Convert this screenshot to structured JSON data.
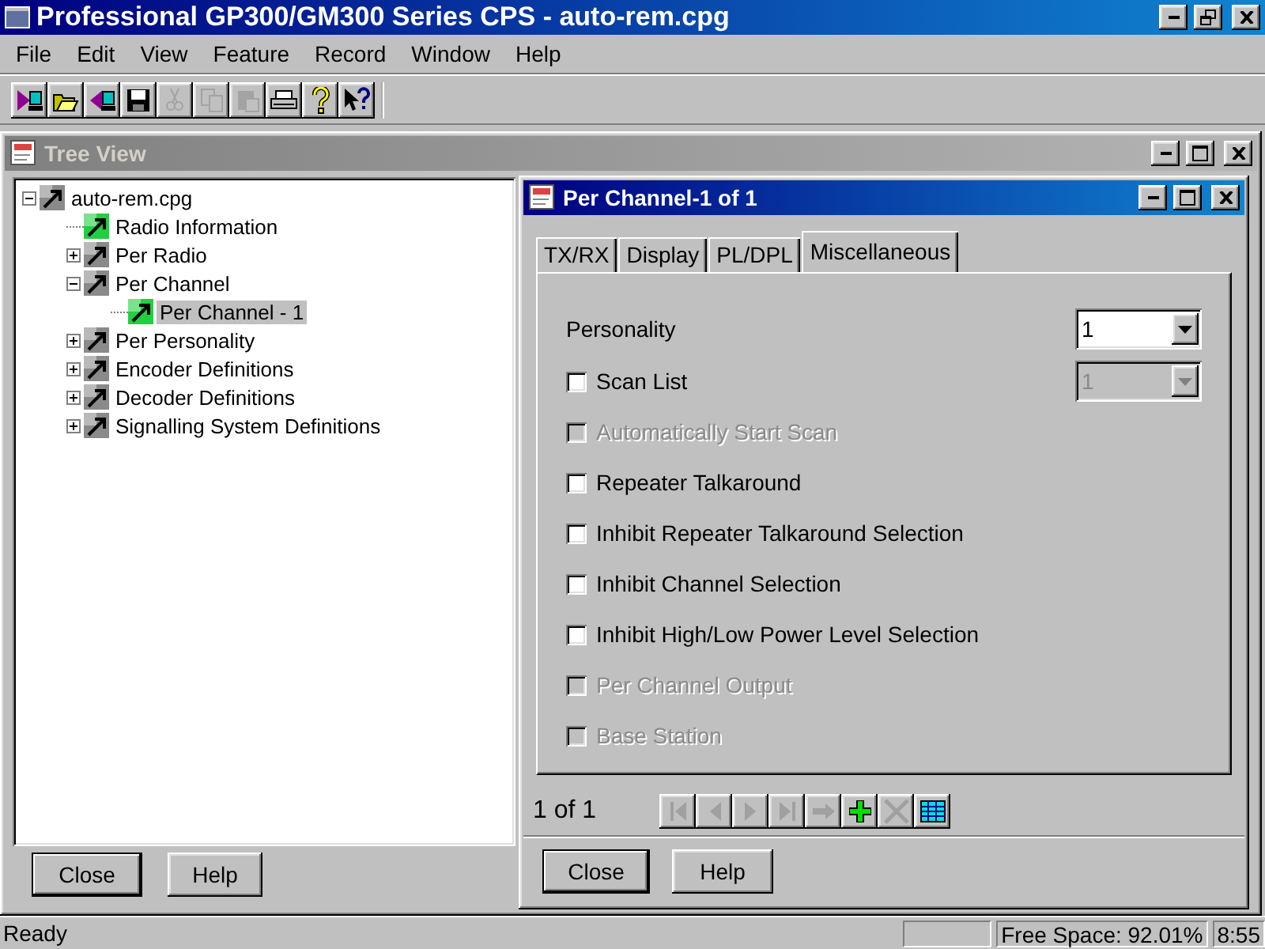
{
  "window": {
    "title": "Professional GP300/GM300 Series CPS - auto-rem.cpg",
    "active": true
  },
  "menu": [
    "File",
    "Edit",
    "View",
    "Feature",
    "Record",
    "Window",
    "Help"
  ],
  "toolbar": [
    {
      "kind": "read",
      "disabled": false
    },
    {
      "kind": "open",
      "disabled": false
    },
    {
      "kind": "write",
      "disabled": false
    },
    {
      "kind": "save",
      "disabled": false
    },
    {
      "kind": "cut",
      "disabled": true
    },
    {
      "kind": "copy",
      "disabled": true
    },
    {
      "kind": "paste",
      "disabled": true
    },
    {
      "kind": "print",
      "disabled": false
    },
    {
      "kind": "help",
      "disabled": false
    },
    {
      "kind": "whats-this",
      "disabled": false
    }
  ],
  "tree_view": {
    "title": "Tree View",
    "active": false,
    "items": [
      {
        "label": "auto-rem.cpg",
        "kind": "folder",
        "expanded": true,
        "selected": false,
        "children": [
          {
            "label": "Radio Information",
            "kind": "leaf",
            "selected": false
          },
          {
            "label": "Per Radio",
            "kind": "folder",
            "expanded": false,
            "selected": false
          },
          {
            "label": "Per Channel",
            "kind": "folder",
            "expanded": true,
            "selected": false,
            "children": [
              {
                "label": "Per Channel - 1",
                "kind": "leaf",
                "selected": true
              }
            ]
          },
          {
            "label": "Per Personality",
            "kind": "folder",
            "expanded": false,
            "selected": false
          },
          {
            "label": "Encoder Definitions",
            "kind": "folder",
            "expanded": false,
            "selected": false
          },
          {
            "label": "Decoder Definitions",
            "kind": "folder",
            "expanded": false,
            "selected": false
          },
          {
            "label": "Signalling System Definitions",
            "kind": "folder",
            "expanded": false,
            "selected": false
          }
        ]
      }
    ],
    "buttons": [
      {
        "label": "Close",
        "default": true
      },
      {
        "label": "Help",
        "default": false
      }
    ]
  },
  "channel_window": {
    "title": "Per Channel-1 of 1",
    "active": true,
    "tabs": [
      {
        "label": "TX/RX",
        "selected": false
      },
      {
        "label": "Display",
        "selected": false
      },
      {
        "label": "PL/DPL",
        "selected": false
      },
      {
        "label": "Miscellaneous",
        "selected": true
      }
    ],
    "rows": [
      {
        "kind": "dropdown",
        "label": "Personality",
        "value": "1",
        "disabled": false
      },
      {
        "kind": "checkbox",
        "label": "Scan List",
        "checked": false,
        "disabled": false,
        "dropdown": {
          "value": "1",
          "disabled": true
        }
      },
      {
        "kind": "checkbox",
        "label": "Automatically Start Scan",
        "checked": false,
        "disabled": true
      },
      {
        "kind": "checkbox",
        "label": "Repeater Talkaround",
        "checked": false,
        "disabled": false
      },
      {
        "kind": "checkbox",
        "label": "Inhibit Repeater Talkaround Selection",
        "checked": false,
        "disabled": false
      },
      {
        "kind": "checkbox",
        "label": "Inhibit Channel Selection",
        "checked": false,
        "disabled": false
      },
      {
        "kind": "checkbox",
        "label": "Inhibit High/Low Power Level Selection",
        "checked": false,
        "disabled": false
      },
      {
        "kind": "checkbox",
        "label": "Per Channel Output",
        "checked": false,
        "disabled": true
      },
      {
        "kind": "checkbox",
        "label": "Base Station",
        "checked": false,
        "disabled": true
      }
    ],
    "record_count": "1 of 1",
    "nav": [
      {
        "kind": "first",
        "disabled": true
      },
      {
        "kind": "prev",
        "disabled": true
      },
      {
        "kind": "next",
        "disabled": true
      },
      {
        "kind": "last",
        "disabled": true
      },
      {
        "kind": "goto",
        "disabled": true
      },
      {
        "kind": "add",
        "disabled": false
      },
      {
        "kind": "delete",
        "disabled": true
      },
      {
        "kind": "table",
        "disabled": false
      }
    ],
    "buttons": [
      {
        "label": "Close",
        "default": true
      },
      {
        "label": "Help",
        "default": false
      }
    ]
  },
  "status_bar": {
    "message": "Ready",
    "panes": [
      "Free Space: 92.01%",
      "8:55"
    ]
  }
}
